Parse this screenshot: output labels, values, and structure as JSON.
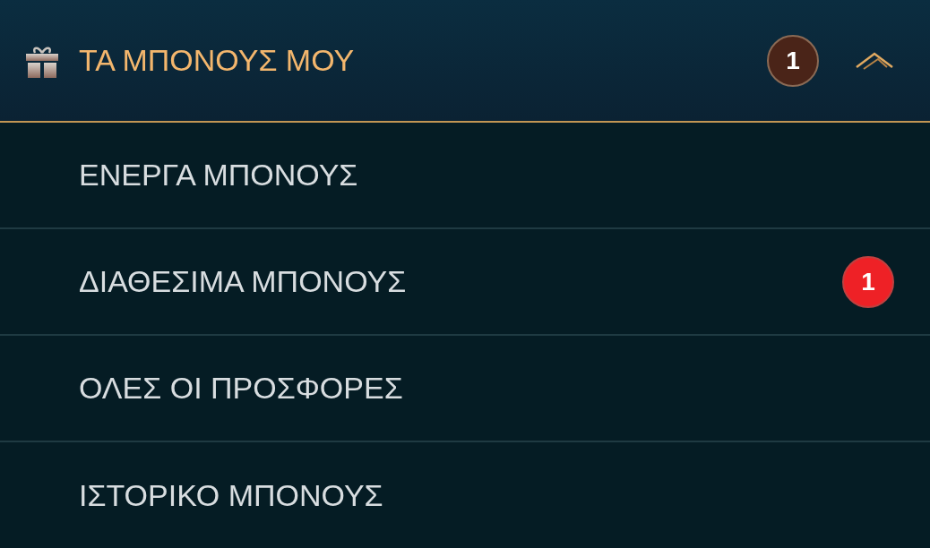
{
  "header": {
    "title": "ΤΑ ΜΠΟΝΟΥΣ ΜΟΥ",
    "badge": {
      "count": "1",
      "color": "#4a2418"
    },
    "expanded": true
  },
  "items": [
    {
      "label": "ΕΝΕΡΓΑ ΜΠΟΝΟΥΣ"
    },
    {
      "label": "ΔΙΑΘΕΣΙΜΑ ΜΠΟΝΟΥΣ",
      "badge": {
        "count": "1",
        "color": "#ee2126"
      }
    },
    {
      "label": "ΟΛΕΣ ΟΙ ΠΡΟΣΦΟΡΕΣ"
    },
    {
      "label": "ΙΣΤΟΡΙΚΟ ΜΠΟΝΟΥΣ"
    }
  ]
}
